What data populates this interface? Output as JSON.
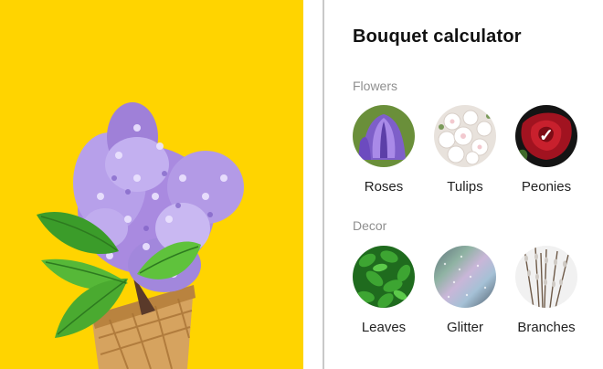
{
  "panel": {
    "title": "Bouquet calculator",
    "flowers_label": "Flowers",
    "decor_label": "Decor"
  },
  "flowers": [
    {
      "label": "Roses",
      "selected": false,
      "swatch": "purple-tulip"
    },
    {
      "label": "Tulips",
      "selected": false,
      "swatch": "white-blossoms"
    },
    {
      "label": "Peonies",
      "selected": true,
      "swatch": "red-rose",
      "check_icon": "✓"
    }
  ],
  "decor": [
    {
      "label": "Leaves",
      "selected": false,
      "swatch": "green-leaves"
    },
    {
      "label": "Glitter",
      "selected": false,
      "swatch": "holographic-glitter"
    },
    {
      "label": "Branches",
      "selected": false,
      "swatch": "pussy-willow-branches"
    }
  ],
  "hero": {
    "subject": "lilac-in-waffle-cone",
    "background": "#ffd400"
  }
}
